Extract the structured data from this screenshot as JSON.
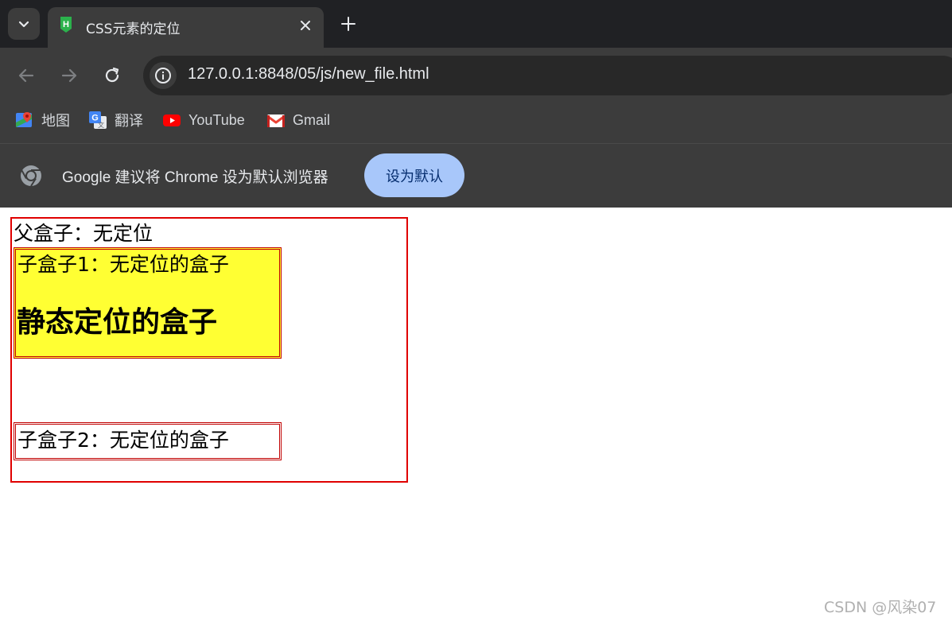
{
  "browser": {
    "tab": {
      "title": "CSS元素的定位",
      "favicon": "hbuilder-icon"
    },
    "address_bar": {
      "url": "127.0.0.1:8848/05/js/new_file.html"
    },
    "bookmarks": [
      {
        "label": "地图",
        "icon": "google-maps-icon"
      },
      {
        "label": "翻译",
        "icon": "google-translate-icon"
      },
      {
        "label": "YouTube",
        "icon": "youtube-icon"
      },
      {
        "label": "Gmail",
        "icon": "gmail-icon"
      }
    ],
    "infobar": {
      "message": "Google 建议将 Chrome 设为默认浏览器",
      "button_label": "设为默认"
    }
  },
  "page": {
    "parent_label": "父盒子：无定位",
    "child1_label": "子盒子1：无定位的盒子",
    "child1_heading": "静态定位的盒子",
    "child2_label": "子盒子2：无定位的盒子"
  },
  "watermark": "CSDN @风染07",
  "colors": {
    "parent_border": "#e00000",
    "child_border": "#c00000",
    "child1_background": "#ffff33",
    "infobar_button": "#a8c7fa"
  }
}
